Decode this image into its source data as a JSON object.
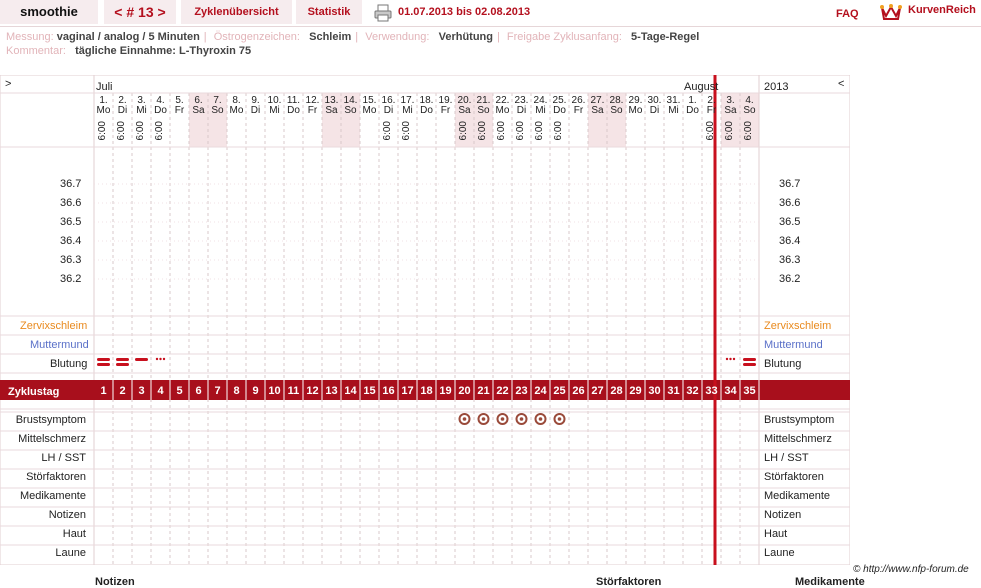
{
  "header": {
    "user_name": "smoothie",
    "cycle_nav": "< # 13 >",
    "tab_overview": "Zyklenübersicht",
    "tab_statistics": "Statistik",
    "date_range": "01.07.2013 bis 02.08.2013",
    "faq": "FAQ",
    "logo_text": "KurvenReich"
  },
  "meta": {
    "messung_label": "Messung:",
    "messung_value": "vaginal / analog / 5 Minuten",
    "oestrogen_label": "Östrogenzeichen:",
    "oestrogen_value": "Schleim",
    "verwendung_label": "Verwendung:",
    "verwendung_value": "Verhütung",
    "freigabe_label": "Freigabe Zyklusanfang:",
    "freigabe_value": "5-Tage-Regel",
    "kommentar_label": "Kommentar:",
    "kommentar_value": "tägliche Einnahme: L-Thyroxin 75"
  },
  "chart": {
    "nav_left": ">",
    "nav_right": "<",
    "month_1": "Juli",
    "month_2": "August",
    "year": "2013",
    "days": [
      {
        "d": "1.",
        "w": "Mo",
        "t": "6:00",
        "weekend": false
      },
      {
        "d": "2.",
        "w": "Di",
        "t": "6:00",
        "weekend": false
      },
      {
        "d": "3.",
        "w": "Mi",
        "t": "6:00",
        "weekend": false
      },
      {
        "d": "4.",
        "w": "Do",
        "t": "6:00",
        "weekend": false
      },
      {
        "d": "5.",
        "w": "Fr",
        "t": "",
        "weekend": false
      },
      {
        "d": "6.",
        "w": "Sa",
        "t": "",
        "weekend": true
      },
      {
        "d": "7.",
        "w": "So",
        "t": "",
        "weekend": true
      },
      {
        "d": "8.",
        "w": "Mo",
        "t": "",
        "weekend": false
      },
      {
        "d": "9.",
        "w": "Di",
        "t": "",
        "weekend": false
      },
      {
        "d": "10.",
        "w": "Mi",
        "t": "",
        "weekend": false
      },
      {
        "d": "11.",
        "w": "Do",
        "t": "",
        "weekend": false
      },
      {
        "d": "12.",
        "w": "Fr",
        "t": "",
        "weekend": false
      },
      {
        "d": "13.",
        "w": "Sa",
        "t": "",
        "weekend": true
      },
      {
        "d": "14.",
        "w": "So",
        "t": "",
        "weekend": true
      },
      {
        "d": "15.",
        "w": "Mo",
        "t": "",
        "weekend": false
      },
      {
        "d": "16.",
        "w": "Di",
        "t": "6:00",
        "weekend": false
      },
      {
        "d": "17.",
        "w": "Mi",
        "t": "6:00",
        "weekend": false
      },
      {
        "d": "18.",
        "w": "Do",
        "t": "",
        "weekend": false
      },
      {
        "d": "19.",
        "w": "Fr",
        "t": "",
        "weekend": false
      },
      {
        "d": "20.",
        "w": "Sa",
        "t": "6:00",
        "weekend": true
      },
      {
        "d": "21.",
        "w": "So",
        "t": "6:00",
        "weekend": true
      },
      {
        "d": "22.",
        "w": "Mo",
        "t": "6:00",
        "weekend": false
      },
      {
        "d": "23.",
        "w": "Di",
        "t": "6:00",
        "weekend": false
      },
      {
        "d": "24.",
        "w": "Mi",
        "t": "6:00",
        "weekend": false
      },
      {
        "d": "25.",
        "w": "Do",
        "t": "6:00",
        "weekend": false
      },
      {
        "d": "26.",
        "w": "Fr",
        "t": "",
        "weekend": false
      },
      {
        "d": "27.",
        "w": "Sa",
        "t": "",
        "weekend": true
      },
      {
        "d": "28.",
        "w": "So",
        "t": "",
        "weekend": true
      },
      {
        "d": "29.",
        "w": "Mo",
        "t": "",
        "weekend": false
      },
      {
        "d": "30.",
        "w": "Di",
        "t": "",
        "weekend": false
      },
      {
        "d": "31.",
        "w": "Mi",
        "t": "",
        "weekend": false
      },
      {
        "d": "1.",
        "w": "Do",
        "t": "",
        "weekend": false
      },
      {
        "d": "2.",
        "w": "Fr",
        "t": "6:00",
        "weekend": false
      },
      {
        "d": "3.",
        "w": "Sa",
        "t": "6:00",
        "weekend": true
      },
      {
        "d": "4.",
        "w": "So",
        "t": "6:00",
        "weekend": true
      }
    ],
    "temps": [
      "36.7",
      "36.6",
      "36.5",
      "36.4",
      "36.3",
      "36.2"
    ],
    "label_zervix": "Zervixschleim",
    "label_muttermund": "Muttermund",
    "label_blutung": "Blutung",
    "blutung": [
      "heavy",
      "heavy",
      "medium",
      "light",
      "",
      "",
      "",
      "",
      "",
      "",
      "",
      "",
      "",
      "",
      "",
      "",
      "",
      "",
      "",
      "",
      "",
      "",
      "",
      "",
      "",
      "",
      "",
      "",
      "",
      "",
      "",
      "",
      "",
      "light",
      "heavy"
    ],
    "label_zyklustag": "Zyklustag",
    "cycle_days": [
      "1",
      "2",
      "3",
      "4",
      "5",
      "6",
      "7",
      "8",
      "9",
      "10",
      "11",
      "12",
      "13",
      "14",
      "15",
      "16",
      "17",
      "18",
      "19",
      "20",
      "21",
      "22",
      "23",
      "24",
      "25",
      "26",
      "27",
      "28",
      "29",
      "30",
      "31",
      "32",
      "33",
      "34",
      "35"
    ],
    "brust_marks": [
      20,
      21,
      22,
      23,
      24,
      25
    ],
    "bottom_rows": [
      "Brustsymptom",
      "Mittelschmerz",
      "LH / SST",
      "Störfaktoren",
      "Medikamente",
      "Notizen",
      "Haut",
      "Laune"
    ],
    "colors": {
      "accent": "#b4101e",
      "zervix": "#e98a1e",
      "muttermund": "#5a70c8",
      "weekend": "#f5e4e6",
      "band": "#a80f1c"
    }
  },
  "footer": {
    "copyright": "© http://www.nfp-forum.de",
    "notizen": "Notizen",
    "stoerfaktoren": "Störfaktoren",
    "medikamente": "Medikamente"
  }
}
